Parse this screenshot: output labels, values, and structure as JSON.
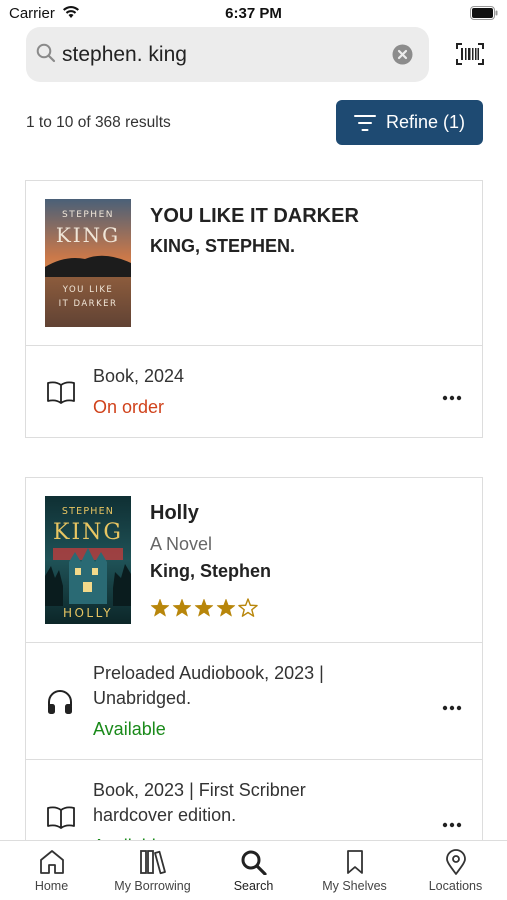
{
  "status_bar": {
    "carrier": "Carrier",
    "time": "6:37 PM"
  },
  "search": {
    "query": "stephen. king"
  },
  "results": {
    "count_text": "1 to 10 of 368 results",
    "refine_label": "Refine (1)"
  },
  "items": [
    {
      "title": "YOU LIKE IT DARKER",
      "author": "KING, STEPHEN.",
      "cover": {
        "line1": "STEPHEN",
        "line2": "KING",
        "line3": "YOU LIKE",
        "line4": "IT DARKER"
      },
      "formats": [
        {
          "icon": "book-icon",
          "line1": "Book, 2024",
          "status": "On order"
        }
      ]
    },
    {
      "title": "Holly",
      "subtitle": "A Novel",
      "author": "King, Stephen",
      "rating": 4,
      "rating_max": 5,
      "cover": {
        "line1": "STEPHEN",
        "line2": "KING",
        "line3": "HOLLY"
      },
      "formats": [
        {
          "icon": "headphones-icon",
          "line1": "Preloaded Audiobook, 2023 |",
          "line2": "Unabridged.",
          "status": "Available"
        },
        {
          "icon": "book-icon",
          "line1": "Book, 2023 | First Scribner",
          "line2": "hardcover edition.",
          "status": "Available"
        }
      ]
    }
  ],
  "tab_bar": {
    "tabs": [
      {
        "label": "Home",
        "icon": "home-icon"
      },
      {
        "label": "My Borrowing",
        "icon": "books-icon"
      },
      {
        "label": "Search",
        "icon": "search-icon",
        "active": true
      },
      {
        "label": "My Shelves",
        "icon": "bookmark-icon"
      },
      {
        "label": "Locations",
        "icon": "location-pin-icon"
      }
    ]
  },
  "colors": {
    "accent": "#1e4a72",
    "on_order": "#d0421b",
    "available": "#1a8a1a",
    "star": "#b8860b"
  }
}
